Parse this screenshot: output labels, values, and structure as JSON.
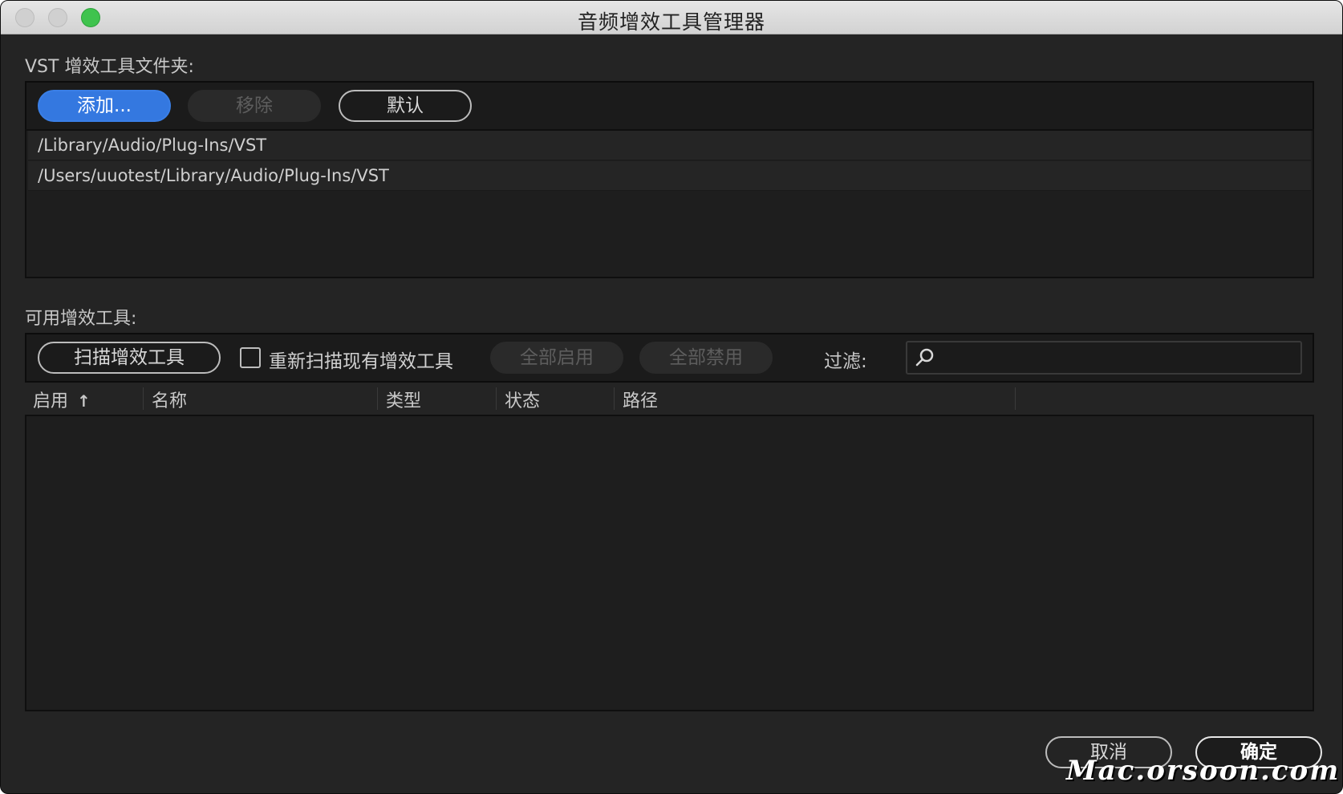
{
  "window": {
    "title": "音频增效工具管理器"
  },
  "vst_section": {
    "label": "VST 增效工具文件夹:",
    "buttons": {
      "add": "添加...",
      "remove": "移除",
      "default": "默认"
    },
    "folders": [
      "/Library/Audio/Plug-Ins/VST",
      "/Users/uuotest/Library/Audio/Plug-Ins/VST"
    ]
  },
  "plugins_section": {
    "label": "可用增效工具:",
    "scan_button": "扫描增效工具",
    "rescan_checkbox": {
      "label": "重新扫描现有增效工具",
      "checked": false
    },
    "enable_all": "全部启用",
    "disable_all": "全部禁用",
    "filter_label": "过滤:",
    "filter_value": "",
    "columns": [
      "启用",
      "名称",
      "类型",
      "状态",
      "路径"
    ],
    "sort_indicator": "↑",
    "rows": []
  },
  "footer": {
    "cancel": "取消",
    "ok": "确定"
  },
  "watermark": "Mac.orsoon.com",
  "colors": {
    "accent": "#3478e0",
    "background": "#242424",
    "close_button": "#3fc34e"
  }
}
